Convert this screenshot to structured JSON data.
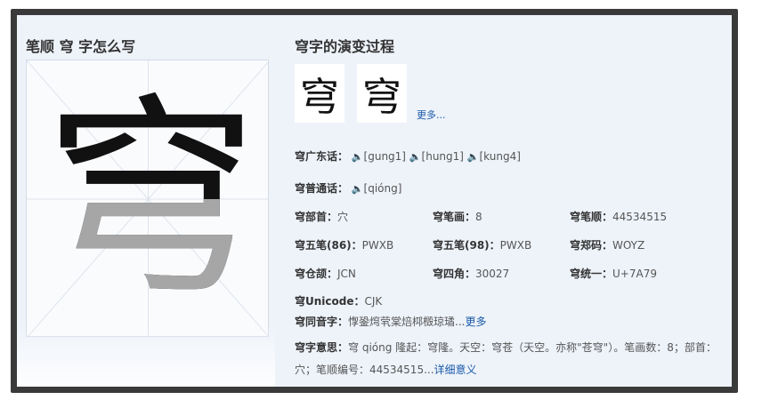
{
  "left": {
    "title": "笔顺 穹 字怎么写",
    "glyph": "穹"
  },
  "evolution": {
    "title": "穹字的演变过程",
    "seal1": "穹",
    "seal2": "穹",
    "more": "更多..."
  },
  "cantonese": {
    "label": "穹广东话：",
    "readings": [
      "[gung1]",
      "[hung1]",
      "[kung4]"
    ]
  },
  "mandarin": {
    "label": "穹普通话：",
    "reading": "[qióng]"
  },
  "props": {
    "radical_label": "穹部首：",
    "radical": "穴",
    "strokes_label": "穹笔画：",
    "strokes": "8",
    "order_label": "穹笔顺：",
    "order": "44534515",
    "wubi86_label": "穹五笔(86)：",
    "wubi86": "PWXB",
    "wubi98_label": "穹五笔(98)：",
    "wubi98": "PWXB",
    "zheng_label": "穹郑码：",
    "zheng": "WOYZ",
    "cangjie_label": "穹仓颉：",
    "cangjie": "JCN",
    "sijiao_label": "穹四角：",
    "sijiao": "30027",
    "unified_label": "穹统一：",
    "unified": "U+7A79",
    "unicode_label": "穹Unicode：",
    "unicode": "CJK"
  },
  "homophones": {
    "label": "穹同音字：",
    "chars": "惸銎焪茕棠焙桏檓琼璚",
    "ellipsis": "...",
    "more": "更多"
  },
  "meaning": {
    "label": "穹字意思：",
    "text": "穹 qióng 隆起：穹隆。天空：穹苍（天空。亦称\"苍穹\"）。笔画数：8；部首：穴；笔顺编号：44534515",
    "ellipsis": "...",
    "more": "详细意义"
  },
  "icons": {
    "sound": "speaker-icon"
  }
}
